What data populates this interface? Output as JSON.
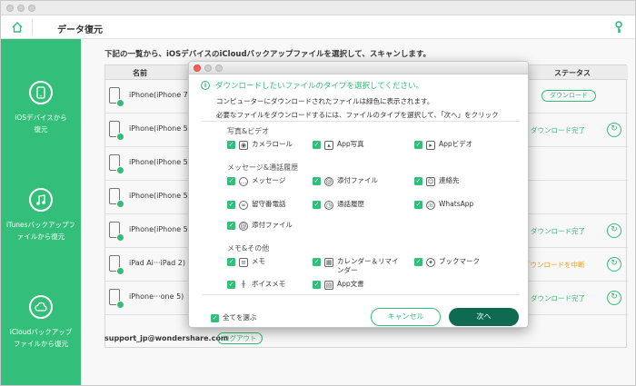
{
  "header": {
    "title": "データ復元"
  },
  "sidebar": {
    "items": [
      {
        "label": "iOSデバイスから復元"
      },
      {
        "label": "iTunesバックアップファイルから復元"
      },
      {
        "label": "iCloudバックアップファイルから復元"
      }
    ]
  },
  "main": {
    "instruction": "下記の一覧から、iOSデバイスのiCloudバックアップファイルを選択して、スキャンします。",
    "columns": {
      "name": "名前",
      "status": "ステータス"
    },
    "rows": [
      {
        "name": "iPhone(iPhone 7)",
        "status": "ダウンロード",
        "status_type": "button"
      },
      {
        "name": "iPhone(iPhone 5)",
        "status": "ダウンロード完了",
        "status_type": "done"
      },
      {
        "name": "iPhone(iPhone 5)",
        "status": "",
        "status_type": "none"
      },
      {
        "name": "iPhone(iPhone 5)",
        "status": "",
        "status_type": "none"
      },
      {
        "name": "iPhone(iPhone 5)",
        "status": "ダウンロード完了",
        "status_type": "done"
      },
      {
        "name": "iPad Ai···iPad 2)",
        "status": "ダウンロードを中断",
        "status_type": "paused"
      },
      {
        "name": "iPhone···one 5)",
        "status": "ダウンロード完了",
        "status_type": "done"
      }
    ],
    "email": "support_jp@wondershare.com",
    "logout": "ログアウト"
  },
  "dialog": {
    "heading": "ダウンロードしたいファイルのタイプを選択してください。",
    "sub1": "コンピューターにダウンロードされたファイルは緑色に表示されます。",
    "sub2": "必要なファイルをダウンロードするには、ファイルのタイプを選択して、「次へ」をクリック",
    "categories": {
      "photo": "写真&ビデオ",
      "message": "メッセージ&通話履歴",
      "memo": "メモ&その他"
    },
    "options": {
      "camera_roll": "カメラロール",
      "app_photo": "App写真",
      "app_video": "Appビデオ",
      "messages": "メッセージ",
      "attachments": "添付ファイル",
      "contacts": "連絡先",
      "voicemail": "留守番電話",
      "call_history": "通話履歴",
      "whatsapp": "WhatsApp",
      "attachments2": "添付ファイル",
      "notes": "メモ",
      "calendar": "カレンダー＆リマインダー",
      "bookmarks": "ブックマーク",
      "voice_memo": "ボイスメモ",
      "app_docs": "App文書"
    },
    "select_all": "全てを選ぶ",
    "cancel": "キャンセル",
    "next": "次へ"
  },
  "colors": {
    "accent": "#33be79",
    "next_button": "#0e6b52",
    "paused": "#f0a020"
  }
}
